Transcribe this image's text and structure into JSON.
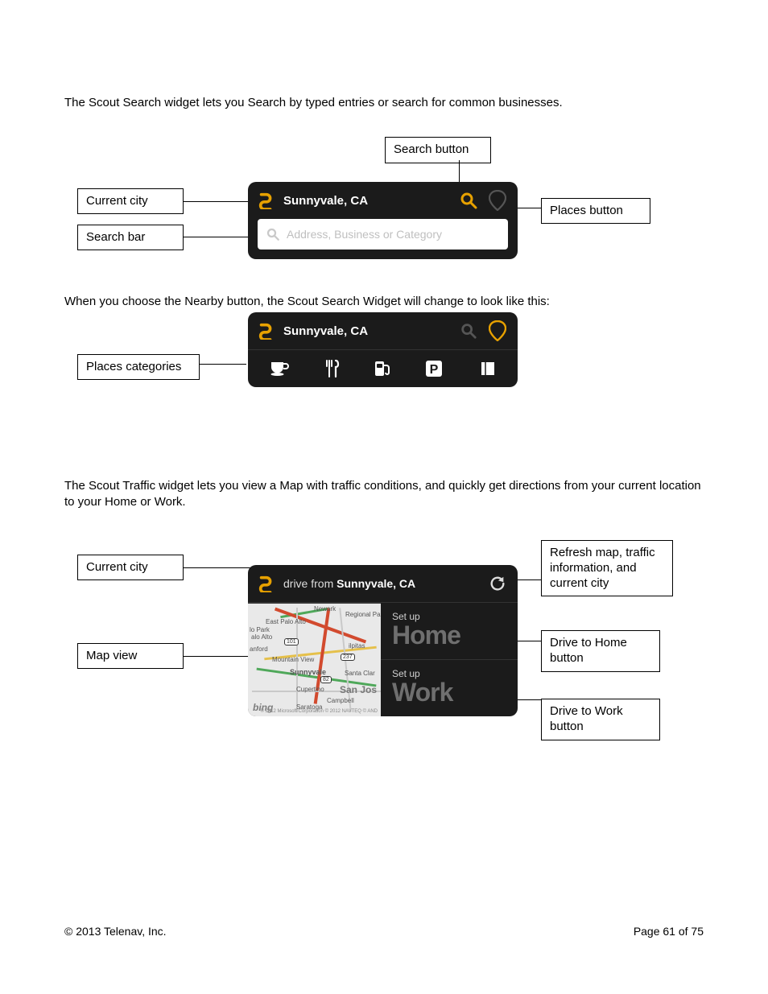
{
  "paragraphs": {
    "p1": "The Scout Search widget lets you Search by typed entries or search for common businesses.",
    "p2": "When you choose the Nearby button, the Scout Search Widget will change to look like this:",
    "p3": "The Scout Traffic widget lets you view a Map with traffic conditions, and quickly get directions from your current location to your Home or Work."
  },
  "callouts": {
    "search_button": "Search button",
    "current_city_1": "Current city",
    "search_bar": "Search bar",
    "places_button": "Places button",
    "places_categories": "Places categories",
    "current_city_3": "Current city",
    "map_view": "Map view",
    "refresh": "Refresh map, traffic information, and current city",
    "drive_home": "Drive to Home button",
    "drive_work": "Drive to Work button"
  },
  "widget1": {
    "city": "Sunnyvale, CA",
    "placeholder": "Address, Business or Category"
  },
  "widget2": {
    "city": "Sunnyvale, CA"
  },
  "widget3": {
    "drive_from_prefix": "drive from ",
    "drive_from_city": "Sunnyvale, CA",
    "setup": "Set up",
    "home": "Home",
    "work": "Work",
    "map_provider": "bing",
    "map_labels": {
      "east_palo_alto": "East Palo Alto",
      "lo_park": "lo Park",
      "alo_alto": "alo Alto",
      "anford": "anford",
      "mountain_view": "Mountain View",
      "sunnyvale": "Sunnyvale",
      "cupertino": "Cupertino",
      "san_jose": "San Jos",
      "campbell": "Campbell",
      "saratoga": "Saratoga",
      "milpitas": "ilpitas",
      "santa_clara": "Santa Clar",
      "regional_park": "Regional Park",
      "newark": "Newark",
      "fineprint": "© 2012 Microsoft Corporation\n© 2012 NAVTEQ © AND"
    },
    "hwy": {
      "a": "101",
      "b": "82",
      "c": "237"
    }
  },
  "footer": {
    "copyright": "© 2013 Telenav, Inc.",
    "page": "Page 61 of 75"
  }
}
